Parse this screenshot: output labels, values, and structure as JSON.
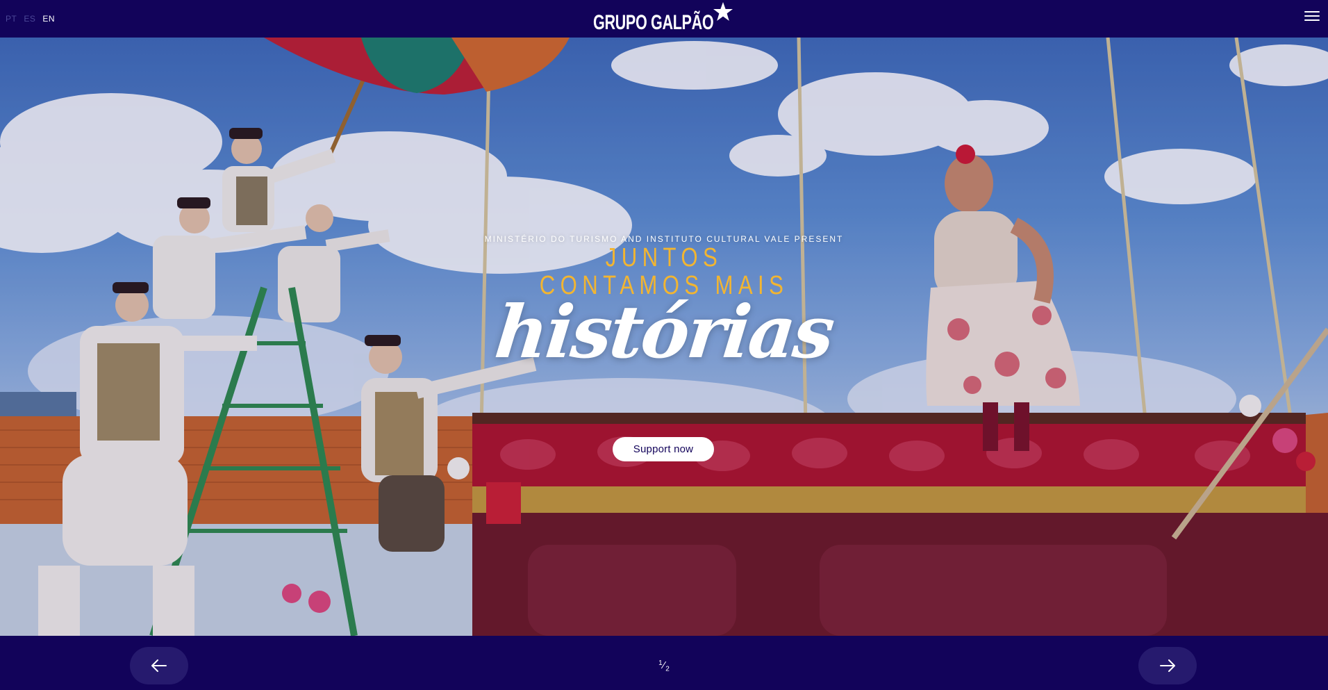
{
  "header": {
    "languages": [
      {
        "code": "PT",
        "active": false
      },
      {
        "code": "ES",
        "active": false
      },
      {
        "code": "EN",
        "active": true
      }
    ],
    "logo_text": "GRUPO GALPÃO",
    "logo_icon": "star-icon",
    "menu_icon": "hamburger-menu-icon"
  },
  "hero": {
    "presenter": "MINISTÉRIO DO TURISMO AND INSTITUTO CULTURAL VALE PRESENT",
    "title_line1": "JUNTOS",
    "title_line2": "CONTAMOS MAIS",
    "title_script": "histórias",
    "cta_label": "Support now",
    "image": "street theater performers in clown makeup on a ladder under an umbrella, a singer in a floral dress on a red-draped truck stage"
  },
  "slider": {
    "current": "1",
    "total": "2",
    "prev_icon": "arrow-left-icon",
    "next_icon": "arrow-right-icon"
  },
  "colors": {
    "brand_navy": "#12035a",
    "accent_gold": "#f2b531",
    "button_bg": "#ffffff"
  }
}
